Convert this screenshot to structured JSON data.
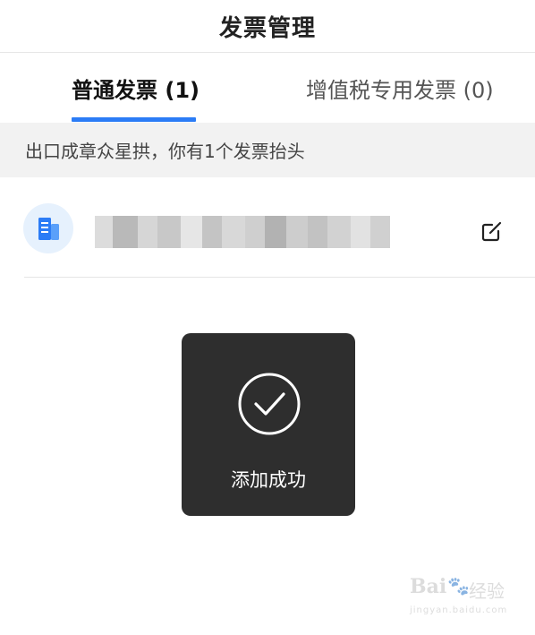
{
  "header": {
    "title": "发票管理"
  },
  "tabs": [
    {
      "label": "普通发票 (1)",
      "active": true
    },
    {
      "label": "增值税专用发票 (0)",
      "active": false
    }
  ],
  "tip": {
    "text": "出口成章众星拱，你有1个发票抬头"
  },
  "invoice": {
    "icon": "building-icon",
    "name_blurred": true,
    "edit_icon": "edit-icon"
  },
  "toast": {
    "icon": "check-circle-icon",
    "text": "添加成功"
  },
  "watermark": {
    "brand": "Bai",
    "brand_cn": "经验",
    "url": "jingyan.baidu.com"
  },
  "colors": {
    "accent": "#2b7cf6",
    "toast_bg": "#2e2e2e",
    "tip_bg": "#f2f2f2"
  }
}
